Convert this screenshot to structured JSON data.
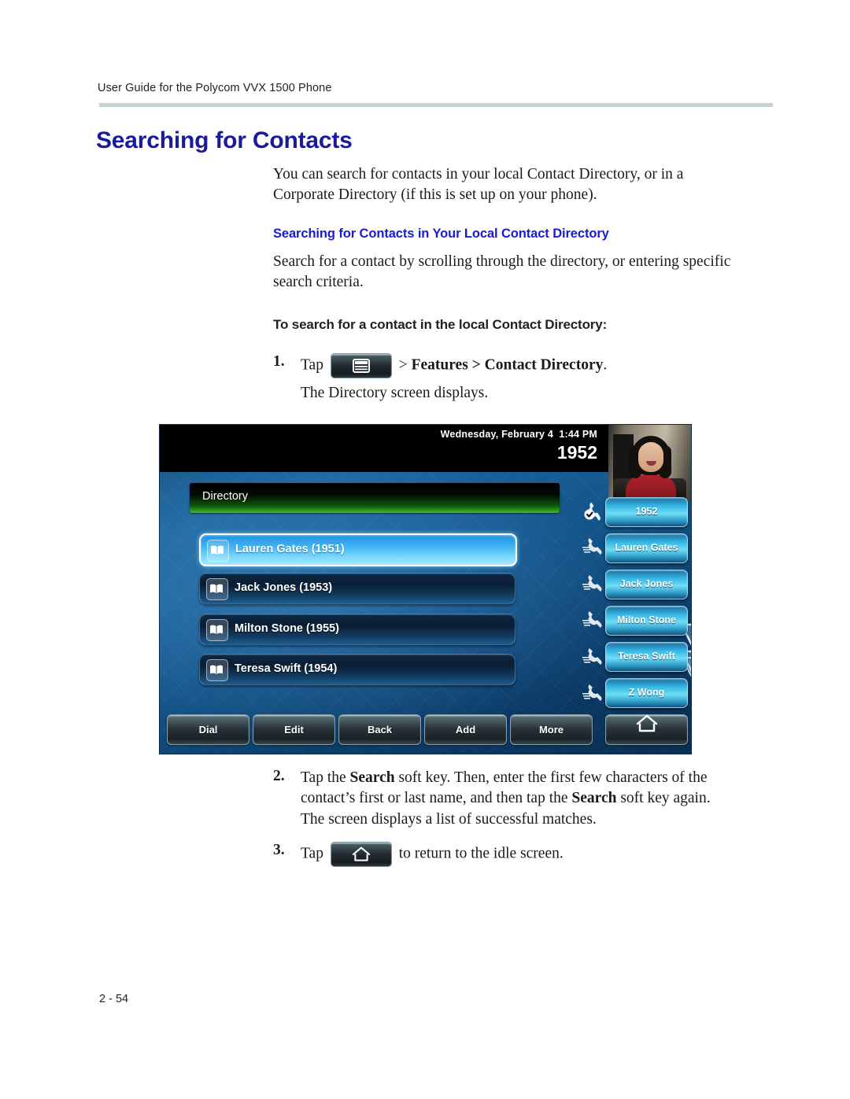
{
  "page": {
    "running_header": "User Guide for the Polycom VVX 1500 Phone",
    "footer": "2 - 54",
    "title": "Searching for Contacts",
    "heading_color": "#1a1a9e",
    "subheading_color": "#1a1ad6",
    "rule_color": "#c3d3cd"
  },
  "intro": {
    "paragraph": "You can search for contacts in your local Contact Directory, or in a Corporate Directory (if this is set up on your phone)."
  },
  "section_local": {
    "heading": "Searching for Contacts in Your Local Contact Directory",
    "paragraph": "Search for a contact by scrolling through the directory, or entering specific search criteria."
  },
  "procedure": {
    "heading": "To search for a contact in the local Contact Directory:",
    "steps": [
      {
        "number": "1.",
        "lead": "Tap",
        "icon": "menu-icon",
        "trail_prefix": "> ",
        "trail_bold": "Features > Contact Directory",
        "trail_suffix": ".",
        "note": "The Directory screen displays."
      },
      {
        "number": "2.",
        "text_a": "Tap the ",
        "bold_a": "Search",
        "text_b": " soft key. Then, enter the first few characters of the contact’s first or last name, and then tap the ",
        "bold_b": "Search",
        "text_c": " soft key again.",
        "note": "The screen displays a list of successful matches."
      },
      {
        "number": "3.",
        "lead": "Tap",
        "icon": "home-icon",
        "trail": "to return to the idle screen."
      }
    ]
  },
  "phone_screen": {
    "status_bar": {
      "datetime": "Wednesday, February 4  1:44 PM",
      "extension": "1952"
    },
    "video_thumbnail": "self-view-video",
    "directory_title": "Directory",
    "contacts": [
      {
        "icon": "contact-book-icon",
        "label": "Lauren Gates (1951)",
        "selected": true
      },
      {
        "icon": "contact-book-icon",
        "label": "Jack Jones (1953)",
        "selected": false
      },
      {
        "icon": "contact-book-icon",
        "label": "Milton Stone (1955)",
        "selected": false
      },
      {
        "icon": "contact-book-icon",
        "label": "Teresa Swift (1954)",
        "selected": false
      }
    ],
    "scroll_indicator": "chevron-down-icon",
    "line_keys": [
      {
        "label": "1952",
        "icon": "handset-registered-icon"
      },
      {
        "label": "Lauren Gates",
        "icon": "handset-icon"
      },
      {
        "label": "Jack Jones",
        "icon": "handset-icon"
      },
      {
        "label": "Milton Stone",
        "icon": "handset-icon"
      },
      {
        "label": "Teresa Swift",
        "icon": "handset-icon"
      },
      {
        "label": "Z Wong",
        "icon": "handset-icon"
      }
    ],
    "soft_keys": [
      {
        "label": "Dial",
        "icon": ""
      },
      {
        "label": "Edit",
        "icon": ""
      },
      {
        "label": "Back",
        "icon": ""
      },
      {
        "label": "Add",
        "icon": ""
      },
      {
        "label": "More",
        "icon": ""
      },
      {
        "label": "",
        "icon": "home-icon"
      }
    ]
  }
}
